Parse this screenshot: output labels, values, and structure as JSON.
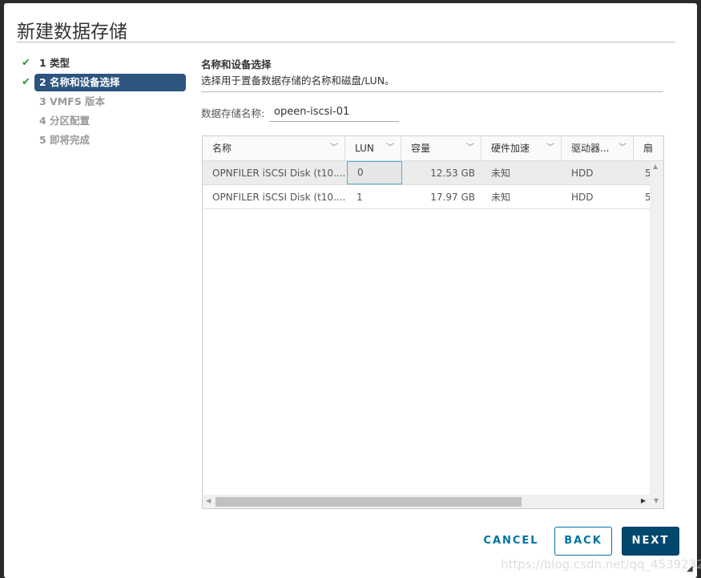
{
  "title": "新建数据存储",
  "steps": [
    {
      "label": "1 类型",
      "state": "done"
    },
    {
      "label": "2 名称和设备选择",
      "state": "active"
    },
    {
      "label": "3 VMFS 版本",
      "state": "pending"
    },
    {
      "label": "4 分区配置",
      "state": "pending"
    },
    {
      "label": "5 即将完成",
      "state": "pending"
    }
  ],
  "section": {
    "heading": "名称和设备选择",
    "description": "选择用于置备数据存储的名称和磁盘/LUN。"
  },
  "name_field": {
    "label": "数据存储名称:",
    "value": "opeen-iscsi-01"
  },
  "table": {
    "columns": [
      "名称",
      "LUN",
      "容量",
      "硬件加速",
      "驱动器...",
      "扇"
    ],
    "rows": [
      [
        "OPNFILER iSCSI Disk (t10....",
        "0",
        "12.53 GB",
        "未知",
        "HDD",
        "5"
      ],
      [
        "OPNFILER iSCSI Disk (t10....",
        "1",
        "17.97 GB",
        "未知",
        "HDD",
        "5"
      ]
    ],
    "selected_row": 0
  },
  "buttons": {
    "cancel": "CANCEL",
    "back": "BACK",
    "next": "NEXT"
  },
  "colors": {
    "accent": "#0072a3",
    "active_step": "#2d5580",
    "next_bg": "#00476e",
    "check": "#2e9c2e"
  },
  "watermark": "https://blog.csdn.net/qq_45392321"
}
